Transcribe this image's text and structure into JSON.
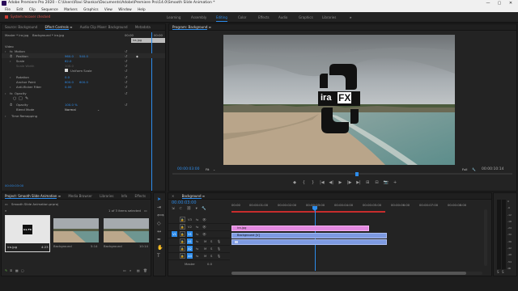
{
  "window": {
    "title": "Adobe Premiere Pro 2020 - C:\\Users\\Ravi Shankar\\Documents\\Adobe\\Premiere Pro\\14.0\\Smooth Slide Animation *",
    "controls": [
      "—",
      "▢",
      "✕"
    ]
  },
  "menu": [
    "File",
    "Edit",
    "Clip",
    "Sequence",
    "Markers",
    "Graphics",
    "View",
    "Window",
    "Help"
  ],
  "workspace": {
    "warning": "System recover checked",
    "tabs": [
      "Learning",
      "Assembly",
      "Editing",
      "Color",
      "Effects",
      "Audio",
      "Graphics",
      "Libraries"
    ],
    "active": "Editing",
    "more": "»"
  },
  "effect_controls": {
    "tabs": [
      "Source: Background",
      "Effect Controls",
      "Audio Clip Mixer: Background",
      "Metadata"
    ],
    "active_tab": "Effect Controls",
    "breadcrumb": "Master * ira.jpg",
    "breadcrumb_seq": "Background * ira.jpg",
    "mini_clip": "ira.jpg",
    "section_video": "Video",
    "motion": "Motion",
    "rows": [
      {
        "label": "Position",
        "v1": "960.0",
        "v2": "540.0"
      },
      {
        "label": "Scale",
        "v1": "62.0",
        "v2": ""
      },
      {
        "label": "Scale Width",
        "v1": "100.0",
        "v2": ""
      },
      {
        "label": "Uniform Scale",
        "v1": "",
        "v2": ""
      },
      {
        "label": "Rotation",
        "v1": "0.0",
        "v2": ""
      },
      {
        "label": "Anchor Point",
        "v1": "600.0",
        "v2": "600.0"
      },
      {
        "label": "Anti-flicker Filter",
        "v1": "0.00",
        "v2": ""
      }
    ],
    "opacity_section": "Opacity",
    "opacity": {
      "label": "Opacity",
      "value": "100.0 %"
    },
    "blend": {
      "label": "Blend Mode",
      "value": "Normal"
    },
    "time_remap": "Time Remapping",
    "timecode": "00:00:03:00",
    "ruler_start": "00:00",
    "ruler_end": "00:00"
  },
  "program": {
    "title": "Program: Background",
    "timecode": "00:00:03:00",
    "fit": "Fit",
    "quality": "Full",
    "duration": "00:00:10:14",
    "logo_text_left": "ira",
    "logo_text_right": "FX",
    "controls": [
      "◆",
      "{",
      "}",
      "|◀",
      "◀|",
      "▶",
      "|▶",
      "▶|",
      "⊞",
      "⊟",
      "📷",
      "+"
    ]
  },
  "project": {
    "tabs": [
      "Project: Smooth Slide Animation",
      "Media Browser",
      "Libraries",
      "Info",
      "Effects"
    ],
    "active_tab": "Project: Smooth Slide Animation",
    "file": "Smooth Slide Animation.prproj",
    "count": "1 of 3 items selected",
    "items": [
      {
        "name": "ira.jpg",
        "duration": "4:23",
        "thumb": "logo"
      },
      {
        "name": "Background",
        "duration": "5:14",
        "thumb": "beach"
      },
      {
        "name": "Background",
        "duration": "10:14",
        "thumb": "beach"
      }
    ]
  },
  "timeline": {
    "title": "Background",
    "timecode": "00:00:03:00",
    "ruler": [
      "00:00",
      "00:00:01:00",
      "00:00:02:00",
      "00:00:03:00",
      "00:00:04:00",
      "00:00:05:00",
      "00:00:06:00",
      "00:00:07:00",
      "00:00:08:00"
    ],
    "tracks": [
      {
        "name": "V3",
        "type": "video"
      },
      {
        "name": "V2",
        "type": "video"
      },
      {
        "name": "V1",
        "type": "video"
      },
      {
        "name": "A1",
        "type": "audio"
      },
      {
        "name": "A2",
        "type": "audio"
      },
      {
        "name": "A3",
        "type": "audio"
      }
    ],
    "source_patch": "V1",
    "master": {
      "label": "Master",
      "value": "0.0"
    },
    "clips": [
      {
        "label": "ira.jpg",
        "color": "#e389e0"
      },
      {
        "label": "Background [V]",
        "color": "#7d9ae1"
      }
    ],
    "meter_labels": [
      "0",
      "-6",
      "-12",
      "-18",
      "-24",
      "-30",
      "-36",
      "-42",
      "-48",
      "-54",
      "dB"
    ]
  },
  "colors": {
    "accent": "#2d8ceb",
    "graphic_clip": "#e389e0",
    "video_clip": "#7d9ae1",
    "warning": "#e0574f"
  }
}
